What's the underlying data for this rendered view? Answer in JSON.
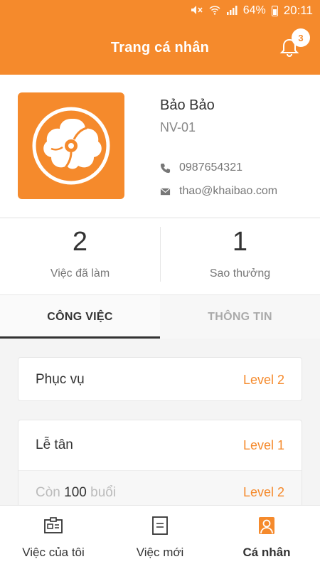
{
  "status_bar": {
    "battery": "64%",
    "time": "20:11"
  },
  "header": {
    "title": "Trang cá nhân",
    "notification_count": "3"
  },
  "profile": {
    "name": "Bảo Bảo",
    "id": "NV-01",
    "phone": "0987654321",
    "email": "thao@khaibao.com"
  },
  "stats": [
    {
      "value": "2",
      "label": "Việc đã làm"
    },
    {
      "value": "1",
      "label": "Sao thưởng"
    }
  ],
  "tabs": [
    {
      "label": "CÔNG VIỆC",
      "active": true
    },
    {
      "label": "THÔNG TIN",
      "active": false
    }
  ],
  "jobs": [
    {
      "name": "Phục vụ",
      "level": "Level 2"
    },
    {
      "name": "Lễ tân",
      "level": "Level 1",
      "sub": {
        "prefix": "Còn",
        "count": "100",
        "suffix": "buổi",
        "level": "Level 2"
      }
    }
  ],
  "bottom_nav": [
    {
      "label": "Việc của tôi",
      "icon": "id-card-icon"
    },
    {
      "label": "Việc mới",
      "icon": "document-icon"
    },
    {
      "label": "Cá nhân",
      "icon": "person-icon",
      "active": true
    }
  ],
  "colors": {
    "accent": "#f58a2c"
  }
}
